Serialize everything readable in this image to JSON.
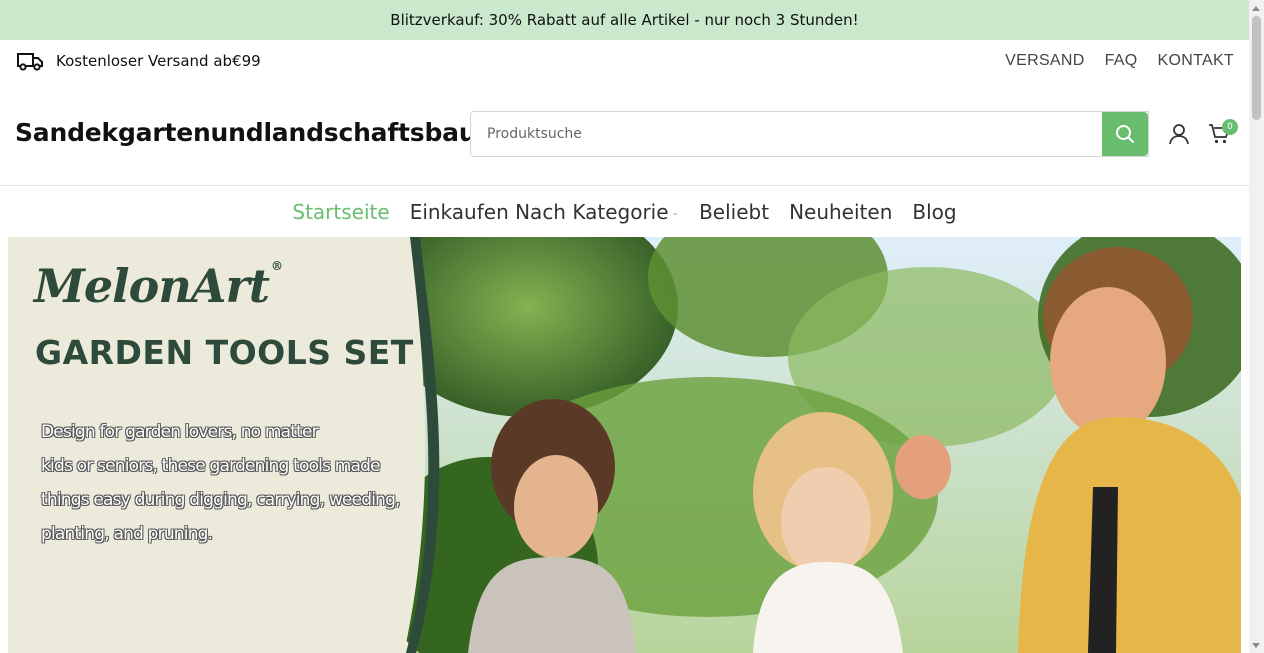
{
  "promo": {
    "text": "Blitzverkauf: 30% Rabatt auf alle Artikel - nur noch 3 Stunden!"
  },
  "topbar": {
    "shipping_text": "Kostenloser Versand ab€99",
    "shipping_icon": "truck-icon",
    "links": [
      "VERSAND",
      "FAQ",
      "KONTAKT"
    ]
  },
  "header": {
    "logo": "Sandekgartenundlandschaftsbau",
    "search_placeholder": "Produktsuche",
    "search_icon": "search-icon",
    "account_icon": "user-icon",
    "cart_icon": "cart-icon",
    "cart_count": "0"
  },
  "nav": {
    "items": [
      {
        "label": "Startseite",
        "active": true
      },
      {
        "label": "Einkaufen Nach Kategorie",
        "has_dropdown": true
      },
      {
        "label": "Beliebt"
      },
      {
        "label": "Neuheiten"
      },
      {
        "label": "Blog"
      }
    ]
  },
  "hero": {
    "brand": "MelonArt",
    "brand_mark": "®",
    "title": "GARDEN TOOLS SET",
    "text_lines": [
      "Design for garden lovers, no matter",
      "kids or seniors, these gardening tools made",
      "things easy during digging, carrying, weeding,",
      "planting, and pruning."
    ]
  },
  "colors": {
    "accent": "#69bd6f",
    "promo_bg": "#c9e8cc",
    "hero_dark": "#2e4a3a",
    "hero_panel": "#eceadb"
  }
}
